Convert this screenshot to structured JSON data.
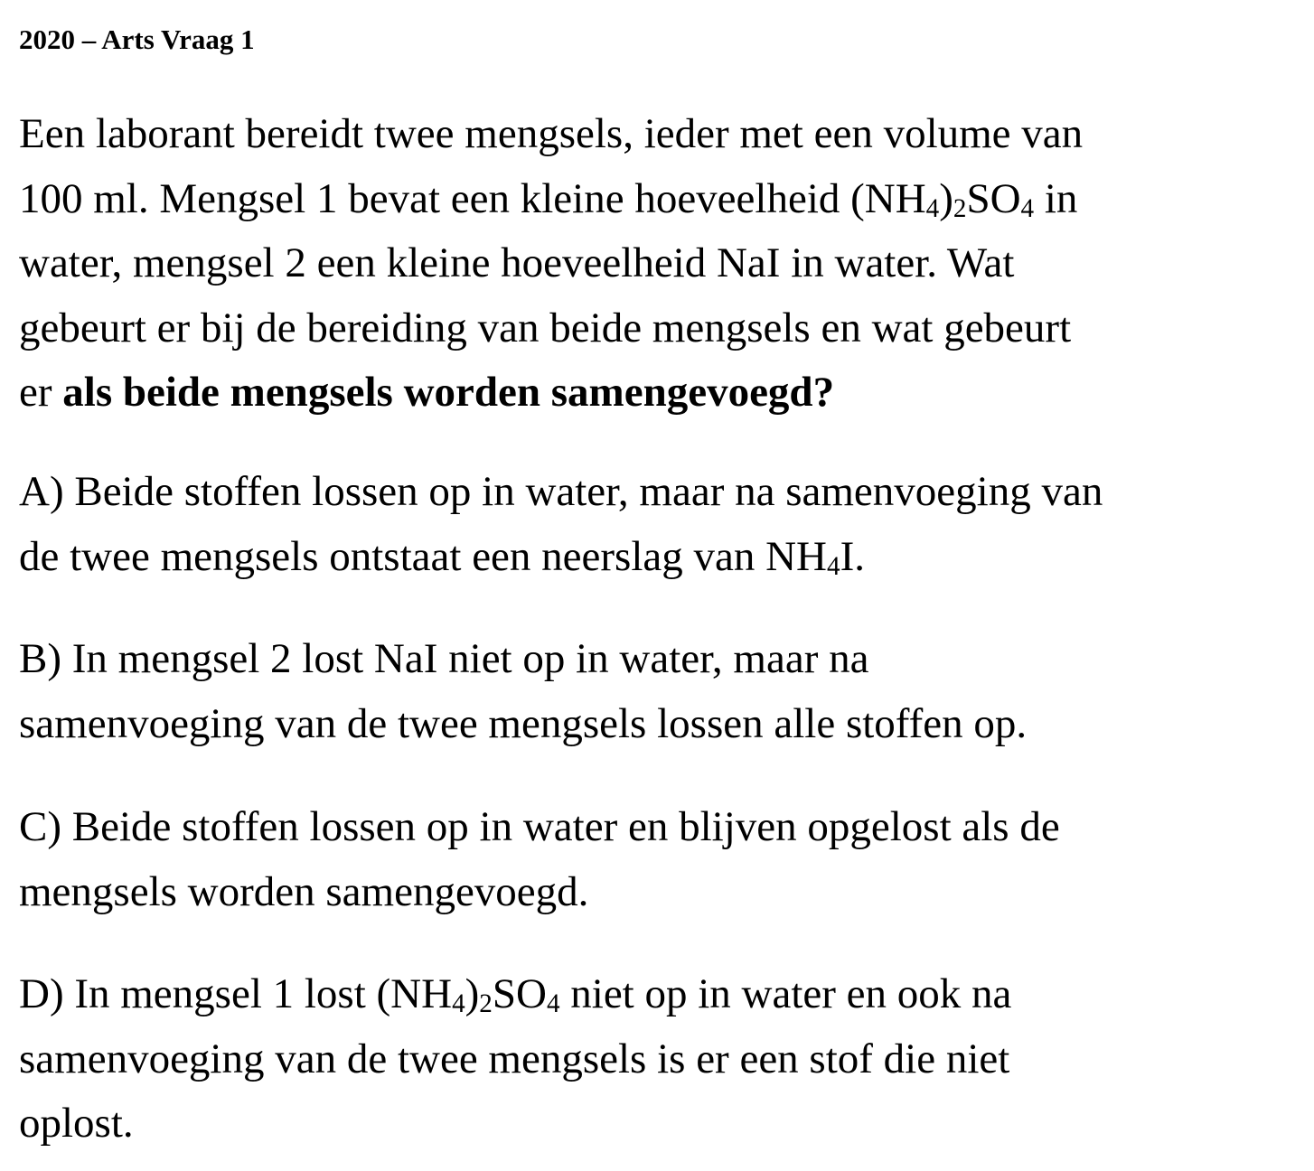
{
  "header": {
    "title": "2020 – Arts Vraag 1"
  },
  "question": {
    "line1": "Een laborant bereidt twee mengsels, ieder met een volume van",
    "line2_pre": "100 ml. Mengsel 1 bevat een kleine hoeveelheid (NH",
    "line2_sub1": "4",
    "line2_mid1": ")",
    "line2_sub2": "2",
    "line2_mid2": "SO",
    "line2_sub3": "4",
    "line2_post": " in",
    "line3": "water, mengsel 2 een kleine hoeveelheid NaI in water. Wat",
    "line4": "gebeurt er bij de bereiding van beide mengsels en wat gebeurt",
    "line5_pre": "er ",
    "line5_bold": "als beide mengsels worden samengevoegd?"
  },
  "options": {
    "a": {
      "line1": "A) Beide stoffen lossen op in water, maar na samenvoeging van",
      "line2_pre": "de twee mengsels ontstaat een neerslag van NH",
      "line2_sub": "4",
      "line2_post": "I."
    },
    "b": {
      "line1": "B) In mengsel 2 lost NaI niet op in water, maar na",
      "line2": "samenvoeging van de twee mengsels lossen alle stoffen op."
    },
    "c": {
      "line1": "C) Beide stoffen lossen op in water en blijven opgelost als de",
      "line2": "mengsels worden samengevoegd."
    },
    "d": {
      "line1_pre": "D) In mengsel 1 lost (NH",
      "line1_sub1": "4",
      "line1_mid1": ")",
      "line1_sub2": "2",
      "line1_mid2": "SO",
      "line1_sub3": "4",
      "line1_post": " niet op in water en ook na",
      "line2": "samenvoeging van de twee mengsels is er een stof die niet",
      "line3": "oplost."
    }
  }
}
